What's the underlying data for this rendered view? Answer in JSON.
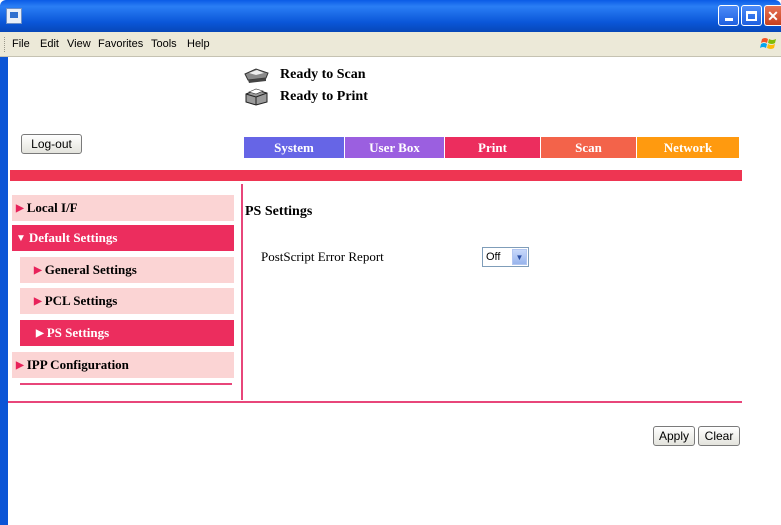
{
  "menu": {
    "items": [
      "File",
      "Edit",
      "View",
      "Favorites",
      "Tools",
      "Help"
    ]
  },
  "window": {
    "minimize_icon": "minimize-icon",
    "maximize_icon": "maximize-icon",
    "close_icon": "close-icon"
  },
  "status": {
    "scan": "Ready to Scan",
    "print": "Ready to Print"
  },
  "logout_label": "Log-out",
  "tabs": [
    {
      "label": "System",
      "color": "#6665e6"
    },
    {
      "label": "User Box",
      "color": "#9b5fe0"
    },
    {
      "label": "Print",
      "color": "#ec2d5e"
    },
    {
      "label": "Scan",
      "color": "#f3634a"
    },
    {
      "label": "Network",
      "color": "#ff9a0f"
    }
  ],
  "nav": {
    "items": [
      {
        "label": "Local I/F",
        "arrow": "▶"
      },
      {
        "label": "Default Settings",
        "arrow": "▼"
      },
      {
        "label": "General Settings",
        "arrow": "▶"
      },
      {
        "label": "PCL Settings",
        "arrow": "▶"
      },
      {
        "label": "PS Settings",
        "arrow": "▶"
      },
      {
        "label": "IPP Configuration",
        "arrow": "▶"
      }
    ]
  },
  "main": {
    "title": "PS Settings",
    "field_label": "PostScript Error Report",
    "field_value": "Off"
  },
  "buttons": {
    "apply": "Apply",
    "clear": "Clear"
  },
  "colors": {
    "accent": "#ee3552",
    "nav_bg": "#fbd4d4",
    "nav_active": "#ec2d5e"
  }
}
